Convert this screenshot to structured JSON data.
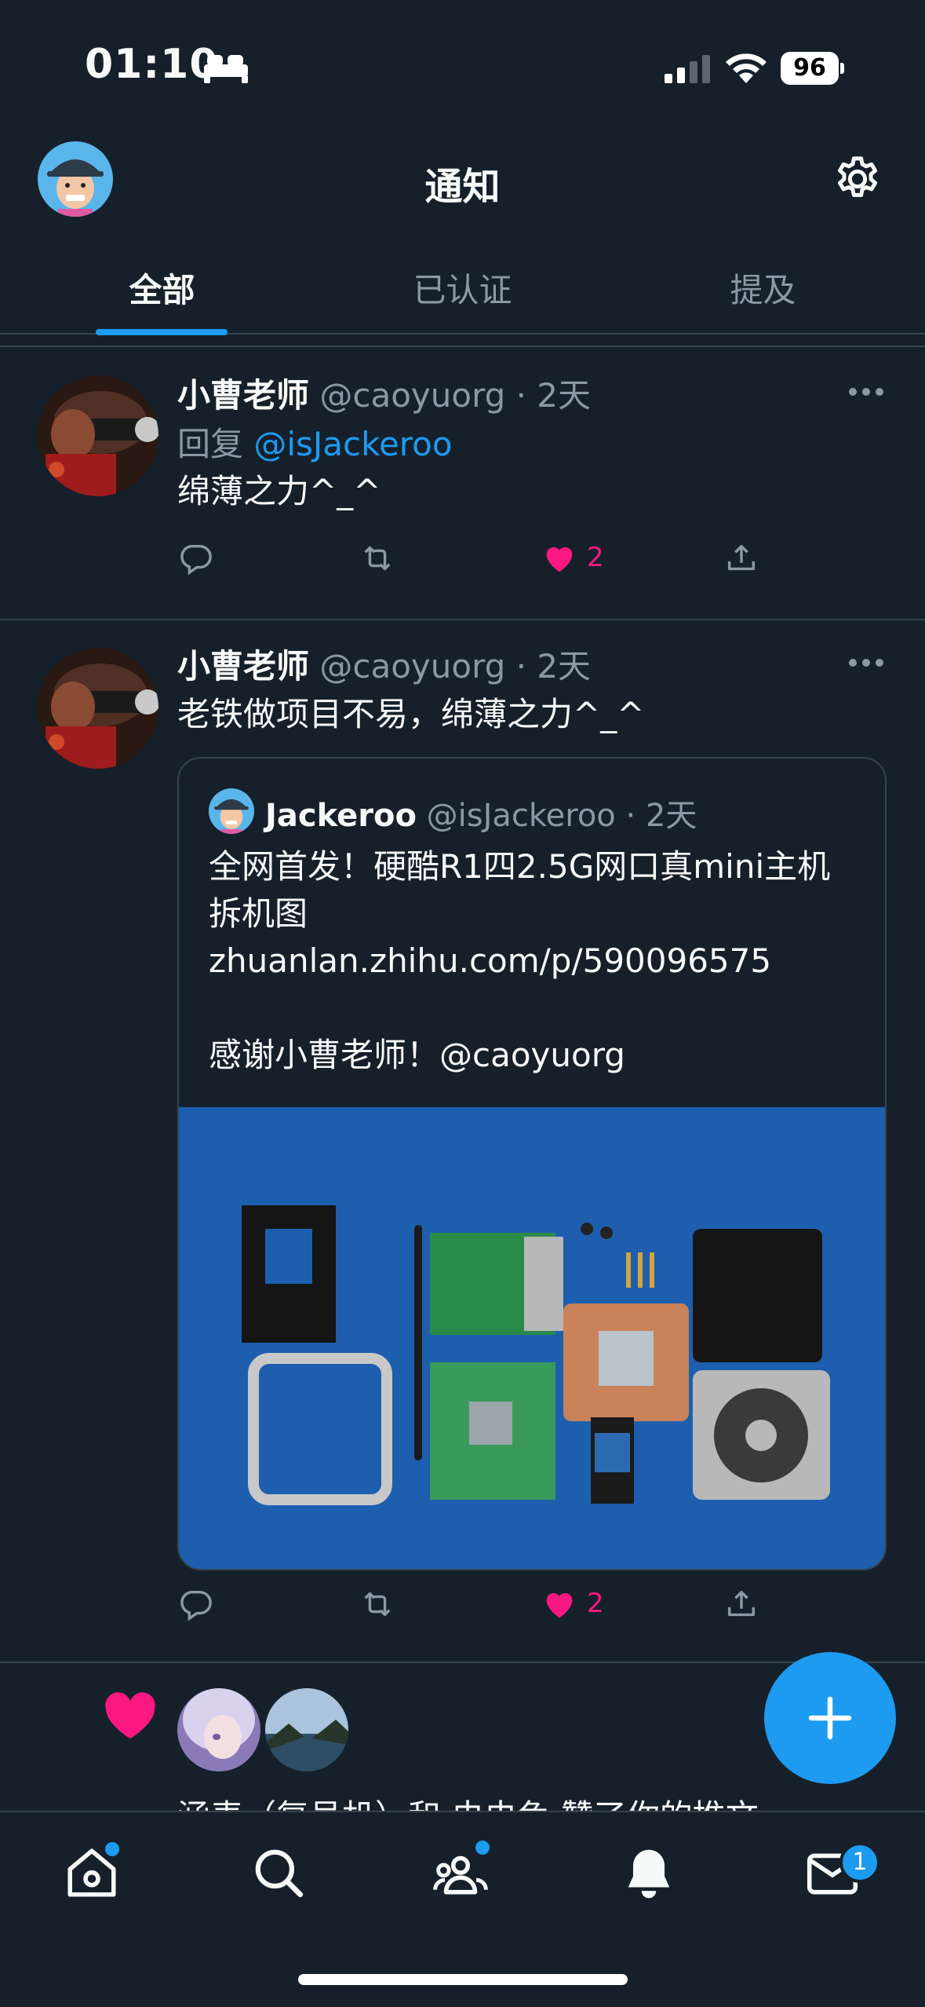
{
  "status_bar": {
    "time": "01:10",
    "battery": "96"
  },
  "header": {
    "title": "通知"
  },
  "tabs": [
    {
      "label": "全部"
    },
    {
      "label": "已认证"
    },
    {
      "label": "提及"
    }
  ],
  "posts": [
    {
      "author_name": "小曹老师",
      "author_handle": "@caoyuorg",
      "time": "2天",
      "reply_prefix": "回复 ",
      "reply_to": "@isJackeroo",
      "text": "绵薄之力^_^",
      "like_count": "2"
    },
    {
      "author_name": "小曹老师",
      "author_handle": "@caoyuorg",
      "time": "2天",
      "text": "老铁做项目不易，绵薄之力^_^",
      "like_count": "2",
      "quote": {
        "author_name": "Jackeroo",
        "author_handle": "@isJackeroo",
        "time": "2天",
        "lines": [
          "全网首发！硬酷R1四2.5G网口真mini主机",
          "拆机图",
          "zhuanlan.zhihu.com/p/590096575",
          "",
          "感谢小曹老师！@caoyuorg"
        ]
      }
    }
  ],
  "like_notification": {
    "text_visible": "‌涵表（复号机）和 虫虫兔 赞了你的推文"
  },
  "bottom_nav": {
    "items": [
      "home",
      "search",
      "communities",
      "notifications",
      "messages"
    ],
    "messages_badge": "1"
  },
  "colors": {
    "accent": "#1d9bf0",
    "like": "#f91880",
    "background": "#15202b"
  }
}
